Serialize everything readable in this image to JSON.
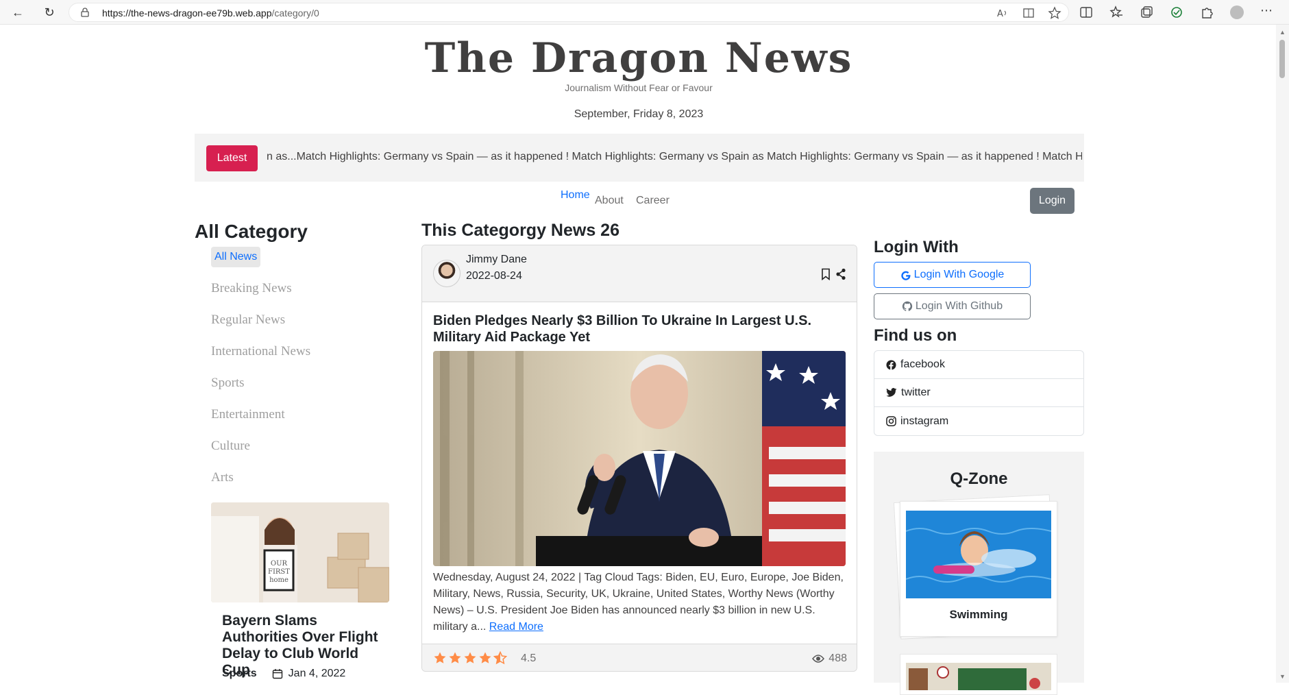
{
  "browser": {
    "url_host": "https://the-news-dragon-ee79b.web.app",
    "url_path": "/category/0"
  },
  "header": {
    "logo": "The Dragon News",
    "tagline": "Journalism Without Fear or Favour",
    "date": "September, Friday 8, 2023"
  },
  "ticker": {
    "badge": "Latest",
    "text": "n as...Match Highlights: Germany vs Spain — as it happened ! Match Highlights: Germany vs Spain as Match Highlights: Germany vs Spain — as it happened ! Match Highl"
  },
  "nav": {
    "home": "Home",
    "about": "About",
    "career": "Career",
    "login": "Login"
  },
  "categories": {
    "title": "All Category",
    "items": [
      "All News",
      "Breaking News",
      "Regular News",
      "International News",
      "Sports",
      "Entertainment",
      "Culture",
      "Arts"
    ]
  },
  "side_card": {
    "title": "Bayern Slams Authorities Over Flight Delay to Club World Cup",
    "category": "Sports",
    "date": "Jan 4, 2022"
  },
  "center": {
    "title": "This Categorgy News 26"
  },
  "news": {
    "author": "Jimmy Dane",
    "published": "2022-08-24",
    "headline": "Biden Pledges Nearly $3 Billion To Ukraine In Largest U.S. Military Aid Package Yet",
    "excerpt": "Wednesday, August 24, 2022 | Tag Cloud Tags: Biden, EU, Euro, Europe, Joe Biden, Military, News, Russia, Security, UK, Ukraine, United States, Worthy News (Worthy News) – U.S. President Joe Biden has announced nearly $3 billion in new U.S. military a...",
    "read_more": "Read More",
    "rating": "4.5",
    "rating_value": 4.5,
    "views": "488"
  },
  "right": {
    "login_with": "Login With",
    "google": "Login With Google",
    "github": "Login With Github",
    "find_us": "Find us on",
    "socials": [
      "facebook",
      "twitter",
      "instagram"
    ],
    "qzone_title": "Q-Zone",
    "qzone_item": "Swimming"
  },
  "colors": {
    "accent": "#d72050",
    "link": "#0d6efd",
    "star": "#ff8c47"
  }
}
